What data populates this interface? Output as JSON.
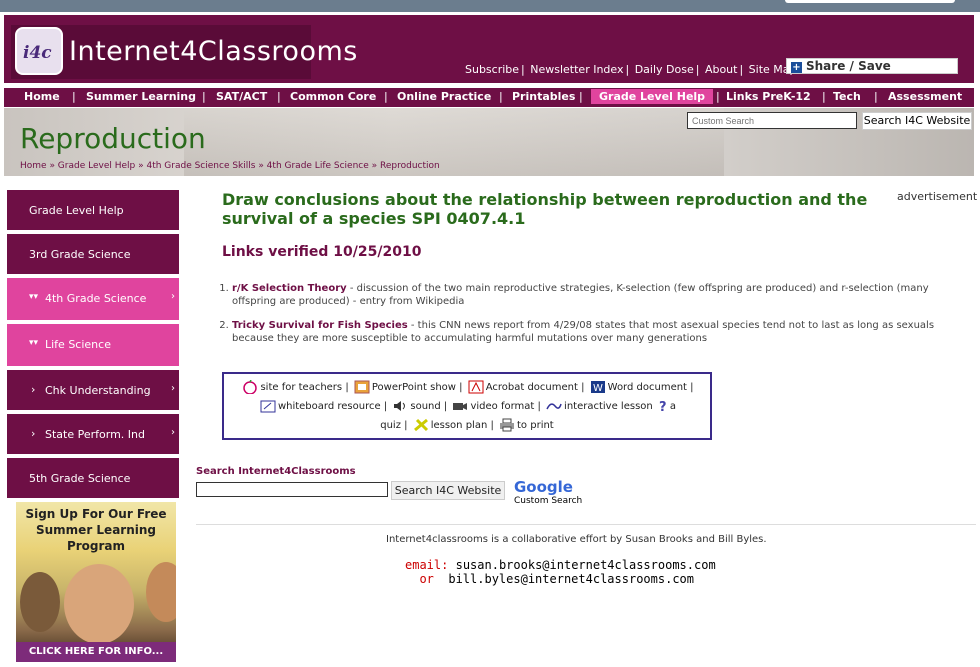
{
  "site": {
    "logo_badge": "i4c",
    "logo_text": "Internet4Classrooms",
    "top_links": [
      "Subscribe",
      "Newsletter Index",
      "Daily Dose",
      "About",
      "Site Map"
    ],
    "share_label": "Share / Save"
  },
  "nav": {
    "items": [
      "Home",
      "Summer Learning",
      "SAT/ACT",
      "Common Core",
      "Online Practice",
      "Printables",
      "Grade Level Help",
      "Links PreK-12",
      "Tech",
      "Assessment"
    ],
    "active": "Grade Level Help"
  },
  "banner": {
    "title": "Reproduction",
    "breadcrumb": "Home » Grade Level Help » 4th Grade Science Skills » 4th Grade Life Science » Reproduction",
    "search_placeholder": "Custom Search",
    "search_button": "Search I4C Website"
  },
  "sidebar": {
    "items": [
      {
        "label": "Grade Level Help",
        "style": "dark"
      },
      {
        "label": "3rd Grade Science",
        "style": "dark"
      },
      {
        "label": "4th Grade Science",
        "style": "pink"
      },
      {
        "label": "Life Science",
        "style": "pink"
      },
      {
        "label": "Chk Understanding",
        "style": "dark"
      },
      {
        "label": "State Perform. Ind",
        "style": "dark"
      },
      {
        "label": "5th Grade Science",
        "style": "dark"
      }
    ],
    "promo_text": "Sign Up For Our Free Summer Learning Program",
    "promo_cta": "CLICK HERE FOR INFO..."
  },
  "content": {
    "heading": "Draw conclusions about the relationship between reproduction and the survival of a species SPI 0407.4.1",
    "advertisement": "advertisement",
    "verified": "Links verified 10/25/2010",
    "links": [
      {
        "title": "r/K Selection Theory",
        "desc": " - discussion of the two main reproductive strategies, K-selection (few offspring are produced) and r-selection (many offspring are produced) - entry from Wikipedia"
      },
      {
        "title": "Tricky Survival for Fish Species",
        "desc": " - this CNN news report from 4/29/08 states that most asexual species tend not to last as long as sexuals because they are more susceptible to accumulating harmful mutations over many generations"
      }
    ],
    "legend": {
      "site_for_teachers": "site for teachers",
      "powerpoint": "PowerPoint show",
      "acrobat": "Acrobat document",
      "word": "Word document",
      "whiteboard": "whiteboard resource",
      "sound": "sound",
      "video": "video format",
      "interactive": "interactive lesson",
      "a": "a",
      "quiz": "quiz",
      "lesson_plan": "lesson plan",
      "print": "to print"
    },
    "search_label": "Search Internet4Classrooms",
    "search_button": "Search I4C Website",
    "google": "Google",
    "custom_search": "Custom Search",
    "footer_text": "Internet4classrooms is a collaborative effort by Susan Brooks and Bill Byles.",
    "email_label": "email:",
    "email1": "susan.brooks@internet4classrooms.com",
    "or_label": "or",
    "email2": "bill.byles@internet4classrooms.com"
  }
}
